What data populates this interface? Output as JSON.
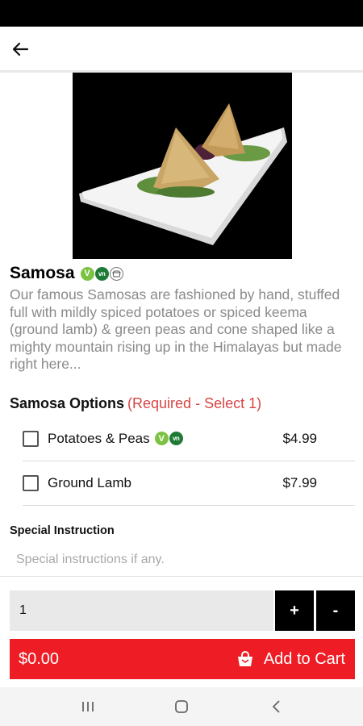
{
  "icons": {
    "back": "arrow-left-icon",
    "cart": "shopping-bag-icon",
    "recents": "recent-apps-icon",
    "home": "home-icon",
    "nav_back": "chevron-left-icon"
  },
  "colors": {
    "accent": "#ee1c24",
    "required": "#d64545",
    "vegetarian": "#7cc243",
    "vegan": "#1f7a35"
  },
  "product": {
    "title": "Samosa",
    "badges": {
      "vegetarian": "V",
      "vegan": "vn"
    },
    "description": "Our famous Samosas are fashioned by hand, stuffed full with mildly spiced potatoes or spiced keema (ground lamb) & green peas and cone shaped like a mighty mountain rising up in the Himalayas but made right here..."
  },
  "options": {
    "heading": "Samosa Options",
    "requirement": "(Required - Select 1)",
    "items": [
      {
        "label": "Potatoes & Peas",
        "price": "$4.99",
        "checked": false,
        "badges": {
          "vegetarian": "V",
          "vegan": "vn"
        }
      },
      {
        "label": "Ground Lamb",
        "price": "$7.99",
        "checked": false
      }
    ]
  },
  "special": {
    "label": "Special Instruction",
    "placeholder": "Special instructions if any.",
    "value": ""
  },
  "quantity": {
    "value": "1",
    "plus": "+",
    "minus": "-"
  },
  "cart": {
    "total": "$0.00",
    "label": "Add to Cart"
  }
}
